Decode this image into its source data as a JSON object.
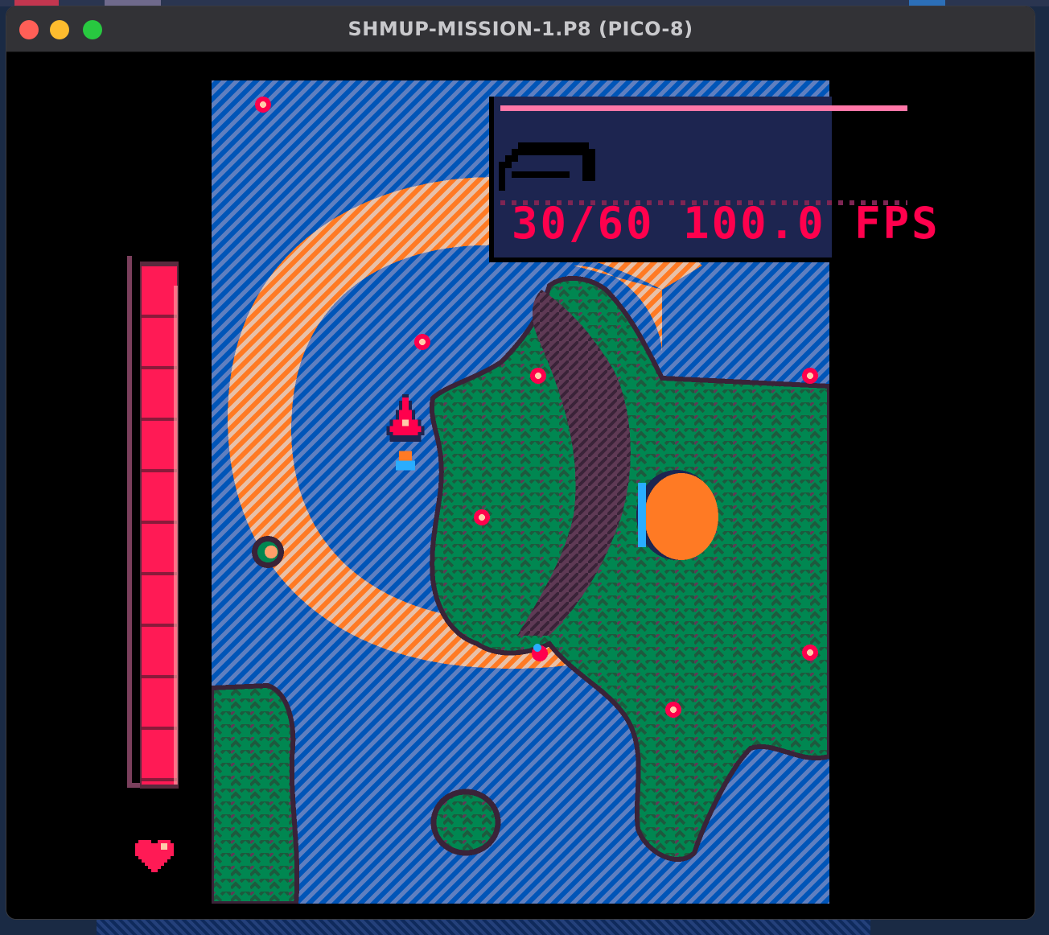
{
  "window": {
    "title": "SHMUP-MISSION-1.P8 (PICO-8)"
  },
  "perf_overlay": {
    "text": "30/60 100.0 FPS"
  },
  "player": {
    "health_fraction": 1.0
  },
  "icons": [
    "close-icon",
    "minimize-icon",
    "maximize-icon",
    "heart-icon",
    "player-ship-icon"
  ],
  "colors": {
    "water": "#0055b8",
    "sand": "#ff7a24",
    "grass": "#008751",
    "rock": "#5f3a55",
    "bullet": "#ff004d",
    "health": "#ff1a55",
    "overlay_bg": "#1d2550",
    "overlay_bar": "#ff77a8"
  }
}
